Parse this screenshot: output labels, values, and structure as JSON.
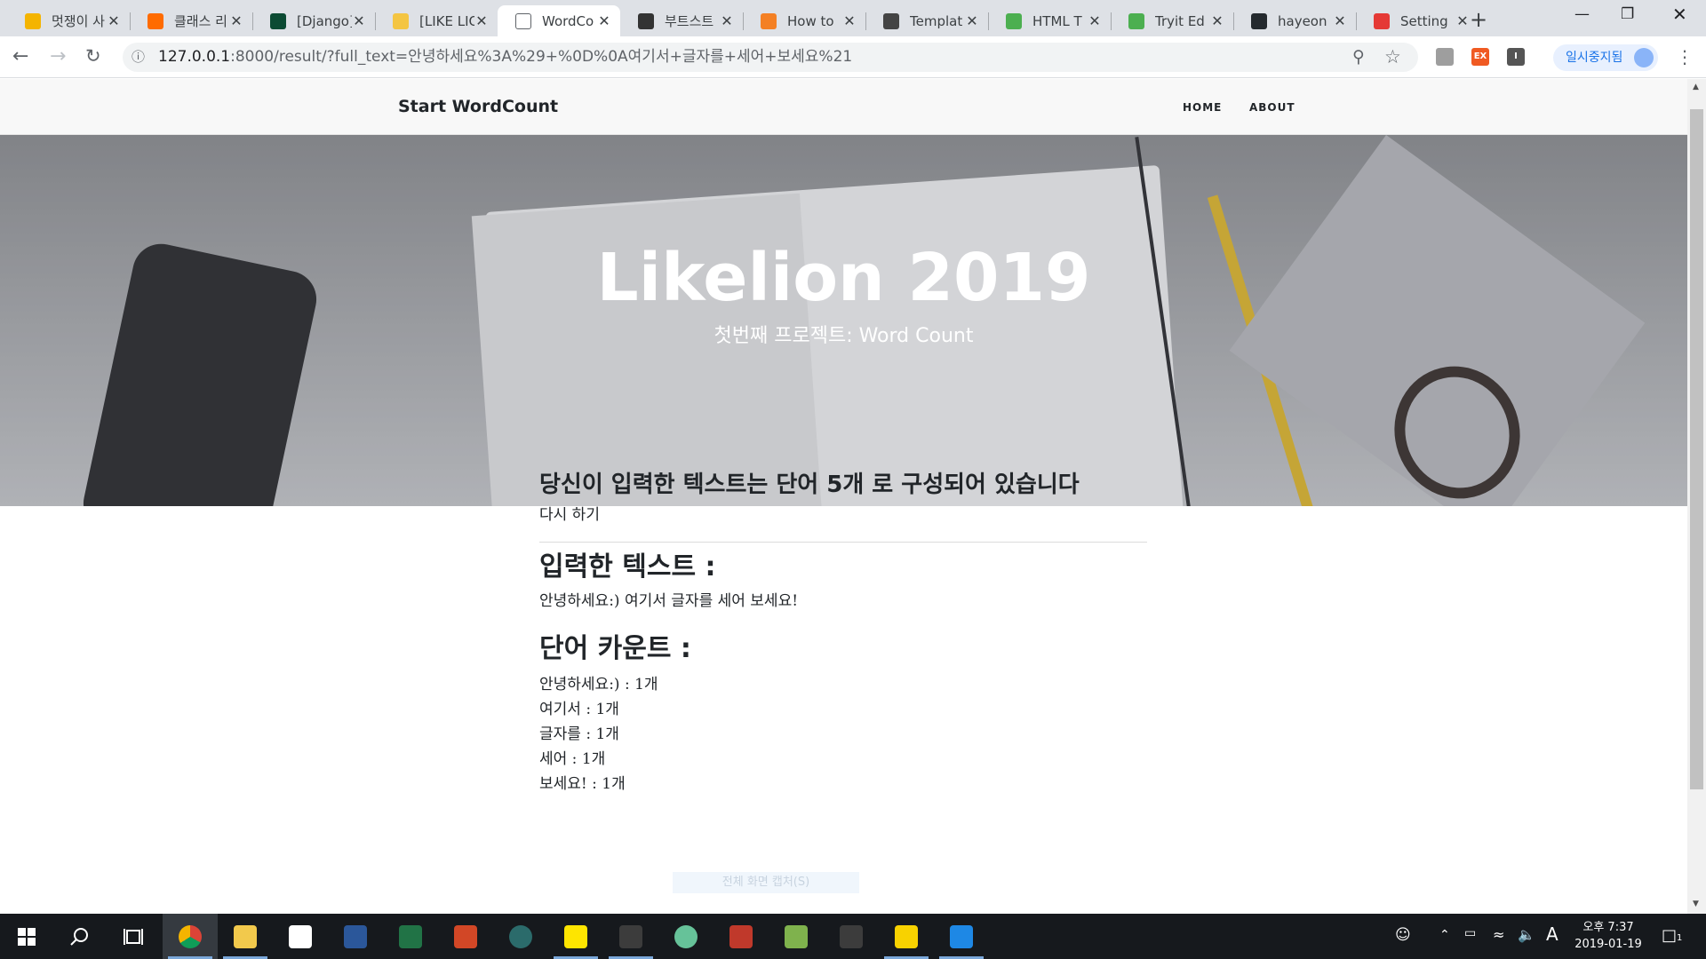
{
  "browser": {
    "tabs": [
      {
        "label": "멋쟁이 사",
        "icon": "home-icon",
        "color": "#f4b400"
      },
      {
        "label": "클래스 리",
        "icon": "class101-icon",
        "color": "#ff6b00"
      },
      {
        "label": "[Django]",
        "icon": "django-icon",
        "color": "#0c4b33"
      },
      {
        "label": "[LIKE LIO",
        "icon": "lion-icon",
        "color": "#f4c542"
      },
      {
        "label": "WordCo",
        "icon": "page-icon",
        "color": "#ffffff",
        "active": true
      },
      {
        "label": "부트스트",
        "icon": "dots-icon",
        "color": "#333333"
      },
      {
        "label": "How to",
        "icon": "stackoverflow-icon",
        "color": "#f48024"
      },
      {
        "label": "Templat",
        "icon": "book-icon",
        "color": "#444444"
      },
      {
        "label": "HTML T",
        "icon": "w3schools-icon",
        "color": "#4caf50"
      },
      {
        "label": "Tryit Ed",
        "icon": "w3schools-icon",
        "color": "#4caf50"
      },
      {
        "label": "hayeon",
        "icon": "github-icon",
        "color": "#24292e"
      },
      {
        "label": "Setting",
        "icon": "z-icon",
        "color": "#e53935"
      }
    ],
    "new_tab": "+",
    "url_host": "127.0.0.1",
    "url_rest": ":8000/result/?full_text=안녕하세요%3A%29+%0D%0A여기서+글자를+세어+보세요%21",
    "profile_label": "일시중지됨",
    "ext_ex": "EX",
    "ext_i": "I"
  },
  "site": {
    "brand": "Start WordCount",
    "nav": [
      {
        "label": "HOME"
      },
      {
        "label": "ABOUT"
      }
    ],
    "hero_title": "Likelion 2019",
    "hero_subtitle": "첫번째 프로젝트: Word Count"
  },
  "result": {
    "headline": "당신이 입력한 텍스트는 단어 5개 로 구성되어 있습니다",
    "retry_label": "다시 하기",
    "input_heading": "입력한 텍스트 :",
    "input_text": "안녕하세요:) 여기서 글자를 세어 보세요!",
    "count_heading": "단어 카운트 :",
    "counts": [
      {
        "text": "안녕하세요:) : 1개"
      },
      {
        "text": "여기서 : 1개"
      },
      {
        "text": "글자를 : 1개"
      },
      {
        "text": "세어 : 1개"
      },
      {
        "text": "보세요! : 1개"
      }
    ],
    "ghost_text": "전체 화면 캡처(S)"
  },
  "taskbar": {
    "apps": [
      {
        "name": "chrome-icon",
        "color": "#db4437",
        "running": true,
        "active": true
      },
      {
        "name": "file-explorer-icon",
        "color": "#f2c94c",
        "running": true
      },
      {
        "name": "mail-icon",
        "color": "#ffffff",
        "running": false
      },
      {
        "name": "word-icon",
        "color": "#2b579a",
        "running": false
      },
      {
        "name": "excel-icon",
        "color": "#217346",
        "running": false
      },
      {
        "name": "powerpoint-icon",
        "color": "#d24726",
        "running": false
      },
      {
        "name": "app-circle-icon",
        "color": "#2b6b6b",
        "running": false
      },
      {
        "name": "kakaotalk-icon",
        "color": "#fee500",
        "running": true
      },
      {
        "name": "terminal-icon",
        "color": "#3c3c3c",
        "running": true
      },
      {
        "name": "atom-icon",
        "color": "#66c299",
        "running": false
      },
      {
        "name": "paint-icon",
        "color": "#c0392b",
        "running": false
      },
      {
        "name": "git-icon",
        "color": "#7fb24d",
        "running": false
      },
      {
        "name": "cmd-icon",
        "color": "#3c3c3c",
        "running": false
      },
      {
        "name": "sticky-notes-icon",
        "color": "#f8d200",
        "running": true
      },
      {
        "name": "vscode-icon",
        "color": "#1e88e5",
        "running": true
      }
    ],
    "ime": "A",
    "time": "오후 7:37",
    "date": "2019-01-19",
    "notif_count": "1"
  }
}
